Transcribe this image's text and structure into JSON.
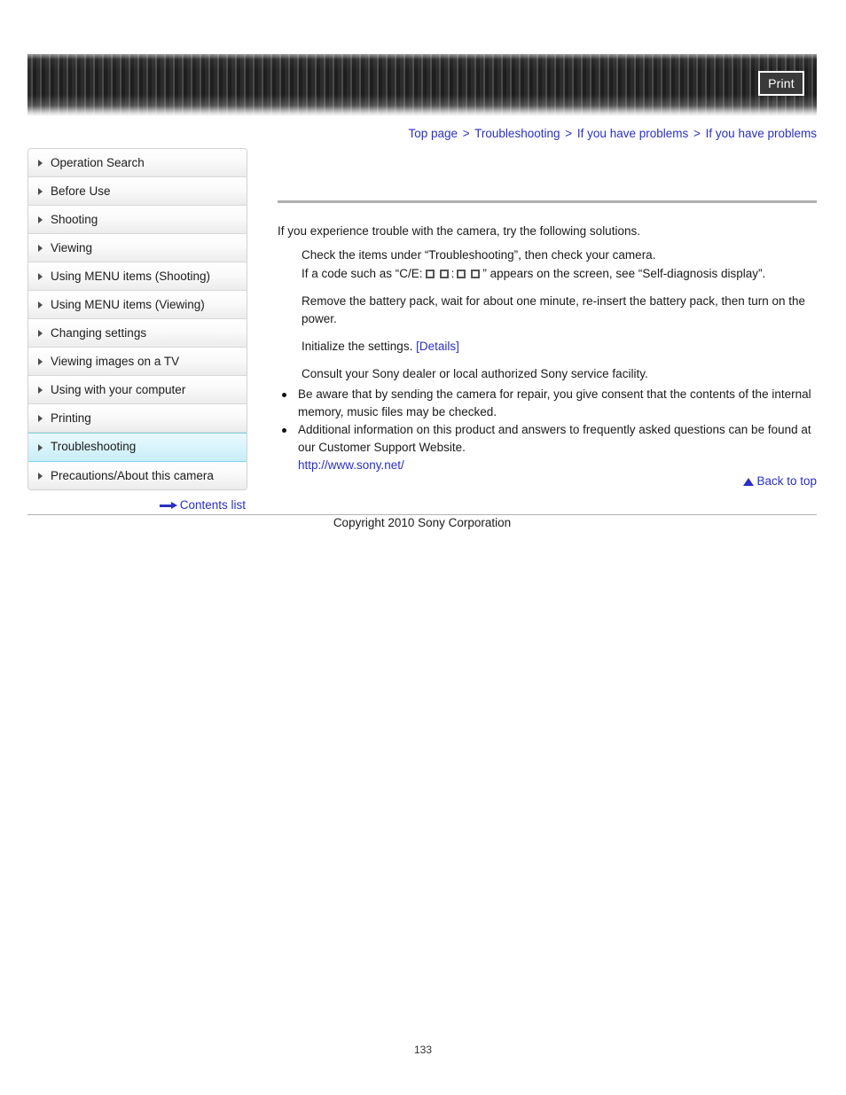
{
  "header": {
    "print_label": "Print"
  },
  "breadcrumb": {
    "separator": ">",
    "items": [
      {
        "label": "Top page"
      },
      {
        "label": "Troubleshooting"
      },
      {
        "label": "If you have problems"
      },
      {
        "label": "If you have problems"
      }
    ]
  },
  "sidebar": {
    "items": [
      {
        "label": "Operation Search",
        "active": false
      },
      {
        "label": "Before Use",
        "active": false
      },
      {
        "label": "Shooting",
        "active": false
      },
      {
        "label": "Viewing",
        "active": false
      },
      {
        "label": "Using MENU items (Shooting)",
        "active": false
      },
      {
        "label": "Using MENU items (Viewing)",
        "active": false
      },
      {
        "label": "Changing settings",
        "active": false
      },
      {
        "label": "Viewing images on a TV",
        "active": false
      },
      {
        "label": "Using with your computer",
        "active": false
      },
      {
        "label": "Printing",
        "active": false
      },
      {
        "label": "Troubleshooting",
        "active": true
      },
      {
        "label": "Precautions/About this camera",
        "active": false
      }
    ],
    "contents_list_label": "Contents list"
  },
  "content": {
    "intro": "If you experience trouble with the camera, try the following solutions.",
    "step1": "Check the items under “Troubleshooting”, then check your camera.",
    "step2_before": "If a code such as “C/E:",
    "step2_colon": ":",
    "step2_after": "” appears on the screen, see “Self-diagnosis display”.",
    "step3": "Remove the battery pack, wait for about one minute, re-insert the battery pack, then turn on the power.",
    "step4_text": "Initialize the settings.",
    "step4_link": "[Details]",
    "step5": "Consult your Sony dealer or local authorized Sony service facility.",
    "bullet1": "Be aware that by sending the camera for repair, you give consent that the contents of the internal memory, music files may be checked.",
    "bullet2": "Additional information on this product and answers to frequently asked questions can be found at our Customer Support Website.",
    "bullet2_url": "http://www.sony.net/"
  },
  "footer": {
    "back_to_top_label": "Back to top",
    "copyright": "Copyright 2010 Sony Corporation",
    "page_number": "133"
  },
  "colors": {
    "link": "#2b2fc4",
    "active_sidebar": "#c8edf8",
    "rule": "#b0b0b0"
  }
}
